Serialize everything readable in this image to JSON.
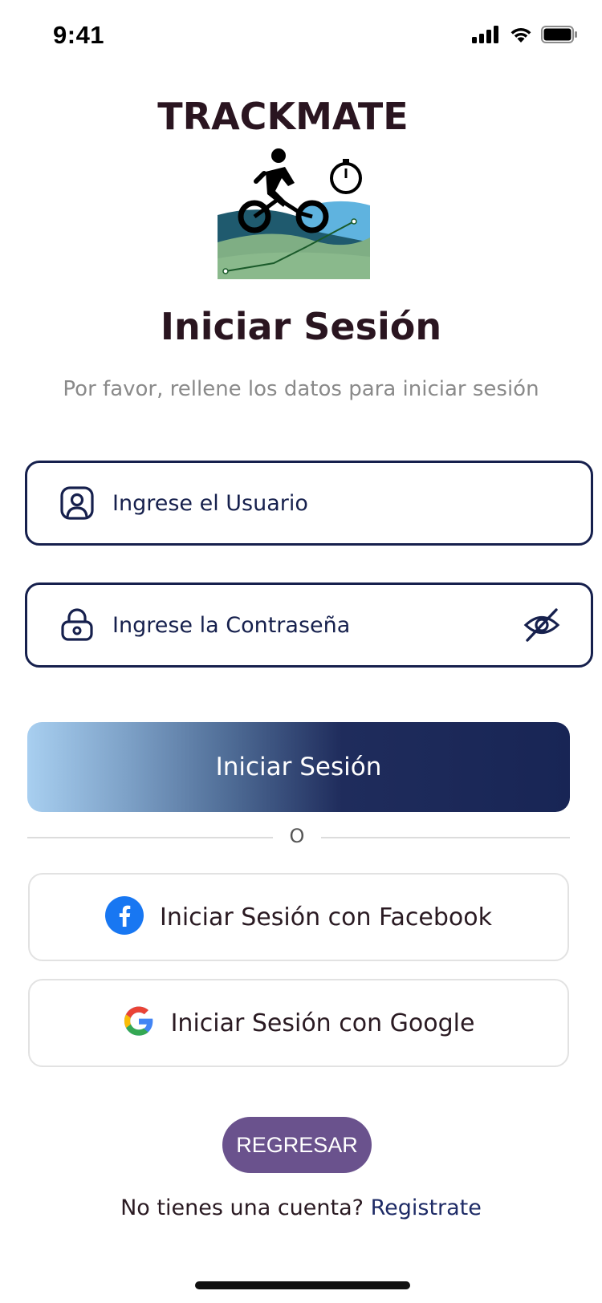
{
  "status_bar": {
    "time": "9:41"
  },
  "header": {
    "app_title": "TRACKMATE",
    "logo_icon": "cyclist-logo-icon",
    "page_title": "Iniciar Sesión",
    "subtitle": "Por favor, rellene los datos para iniciar sesión"
  },
  "form": {
    "username": {
      "placeholder": "Ingrese el Usuario",
      "value": "",
      "icon": "user-icon"
    },
    "password": {
      "placeholder": "Ingrese la Contraseña",
      "value": "",
      "icon": "lock-icon",
      "toggle_icon": "eye-off-icon"
    },
    "submit_label": "Iniciar Sesión"
  },
  "divider": {
    "text": "O"
  },
  "social": {
    "facebook_label": "Iniciar Sesión con Facebook",
    "google_label": "Iniciar Sesión con Google"
  },
  "back_label": "REGRESAR",
  "register": {
    "prompt": "No tienes una cuenta?",
    "link": "Registrate"
  },
  "colors": {
    "primary": "#16204d",
    "back_button": "#6a528d",
    "facebook": "#1877f2",
    "divider": "#dcdcdc"
  }
}
